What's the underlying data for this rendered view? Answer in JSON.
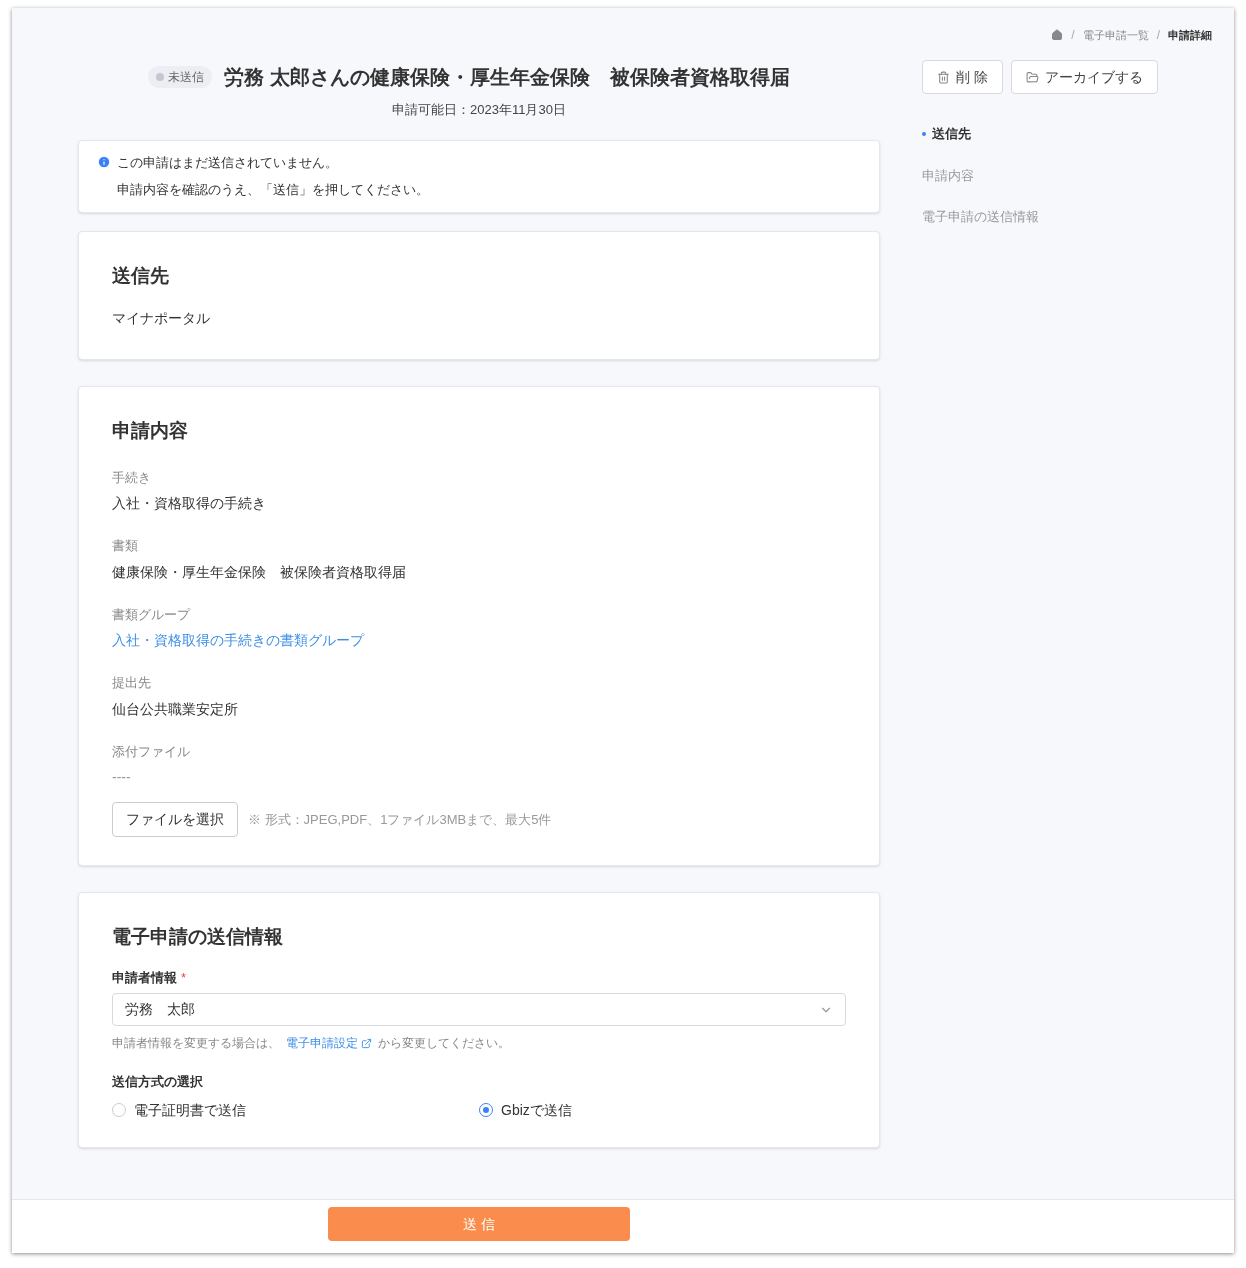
{
  "breadcrumb": [
    {
      "separator": "/",
      "label": "電子申請一覧"
    },
    {
      "separator": "/",
      "label": "申請詳細"
    }
  ],
  "header": {
    "status": "未送信",
    "title": "労務 太郎さんの健康保険・厚生年金保険　被保険者資格取得届",
    "date": "申請可能日：2023年11月30日"
  },
  "actions": [
    {
      "kind": "delete",
      "label": "削 除"
    },
    {
      "kind": "archive",
      "label": "アーカイブする"
    }
  ],
  "toc": [
    {
      "label": "送信先",
      "selected": true
    },
    {
      "label": "申請内容",
      "selected": false
    },
    {
      "label": "電子申請の送信情報",
      "selected": false
    }
  ],
  "notice": [
    "この申請はまだ送信されていません。",
    "申請内容を確認のうえ、「送信」を押してください。"
  ],
  "destination": {
    "heading": "送信先",
    "value": "マイナポータル"
  },
  "content": {
    "heading": "申請内容",
    "fields": [
      {
        "label": "手続き",
        "value": "入社・資格取得の手続き",
        "kind": "text"
      },
      {
        "label": "書類",
        "value": "健康保険・厚生年金保険　被保険者資格取得届",
        "kind": "text"
      },
      {
        "label": "書類グループ",
        "value": "入社・資格取得の手続きの書類グループ",
        "kind": "link"
      },
      {
        "label": "提出先",
        "value": "仙台公共職業安定所",
        "kind": "text"
      },
      {
        "label": "添付ファイル",
        "value": "----",
        "kind": "text"
      }
    ],
    "file_button": "ファイルを選択",
    "file_hint": "※ 形式：JPEG,PDF、1ファイル3MBまで、最大5件"
  },
  "send_info": {
    "heading": "電子申請の送信情報",
    "applicant_label": "申請者情報",
    "required_mark": "*",
    "applicant_value": "労務　太郎",
    "help_before": "申請者情報を変更する場合は、",
    "help_link": "電子申請設定",
    "help_after": "から変更してください。",
    "method_label": "送信方式の選択",
    "methods": [
      {
        "label": "電子証明書で送信",
        "selected": false
      },
      {
        "label": "Gbizで送信",
        "selected": true
      }
    ]
  },
  "submit": "送 信"
}
